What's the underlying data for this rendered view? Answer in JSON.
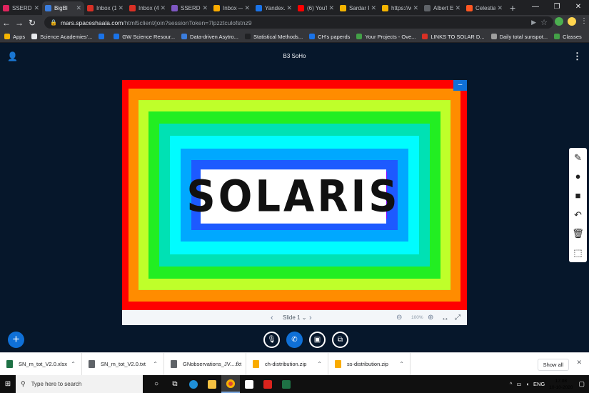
{
  "browser": {
    "tabs": [
      {
        "label": "SSERD #",
        "color": "#e0245e"
      },
      {
        "label": "BigBl",
        "color": "#3b7ddd",
        "active": true
      },
      {
        "label": "Inbox (19",
        "color": "#d93025"
      },
      {
        "label": "Inbox (49",
        "color": "#d93025"
      },
      {
        "label": "SSERD-S",
        "color": "#7e57c2"
      },
      {
        "label": "Inbox —",
        "color": "#f9ab00"
      },
      {
        "label": "Yandex.D",
        "color": "#1a73e8"
      },
      {
        "label": "(6) YouTu",
        "color": "#ff0000"
      },
      {
        "label": "Sardar Pa",
        "color": "#f4b400"
      },
      {
        "label": "https://w",
        "color": "#f4b400"
      },
      {
        "label": "Albert Ein",
        "color": "#5f6368"
      },
      {
        "label": "Celestial",
        "color": "#ff5722"
      }
    ],
    "new_tab": "+",
    "url_domain": "mars.spaceshaala.com",
    "url_path": "/html5client/join?sessionToken=7lpzztculofstnz9",
    "bookmarks": [
      {
        "label": "Apps",
        "color": "#f4b400"
      },
      {
        "label": "Science Academies'...",
        "color": "#e8eaed"
      },
      {
        "label": "",
        "color": "#1a73e8"
      },
      {
        "label": "GW Science Resour...",
        "color": "#1a73e8"
      },
      {
        "label": "Data-driven Asytro...",
        "color": "#3b7ddd"
      },
      {
        "label": "Statistical Methods...",
        "color": "#202124"
      },
      {
        "label": "CH's paperds",
        "color": "#1a73e8"
      },
      {
        "label": "Your Projects - Ove...",
        "color": "#43a047"
      },
      {
        "label": "LINKS TO SOLAR D...",
        "color": "#d93025"
      },
      {
        "label": "Daily total sunspot...",
        "color": "#9e9e9e"
      },
      {
        "label": "Classes",
        "color": "#43a047"
      }
    ]
  },
  "app": {
    "title": "B3 SoHo",
    "slide_text": "SOLARIS",
    "slide_label": "Slide 1",
    "zoom": "100%",
    "ring_colors": [
      "#ff0000",
      "#ff8c00",
      "#bfff2a",
      "#22ee22",
      "#00e1b4",
      "#00fcff",
      "#00a8ff",
      "#1d5aff",
      "#8a00ff"
    ]
  },
  "downloads": {
    "items": [
      {
        "name": "SN_m_tot_V2.0.xlsx",
        "color": "#1e7145"
      },
      {
        "name": "SN_m_tot_V2.0.txt",
        "color": "#5f6368"
      },
      {
        "name": "GNobservations_JV....txt",
        "color": "#5f6368"
      },
      {
        "name": "ch-distribution.zip",
        "color": "#f9ab00"
      },
      {
        "name": "ss-distribution.zip",
        "color": "#f9ab00"
      }
    ],
    "show_all": "Show all"
  },
  "taskbar": {
    "search_placeholder": "Type here to search",
    "language": "ENG",
    "time": "17:08",
    "date": "10-10-2020"
  }
}
